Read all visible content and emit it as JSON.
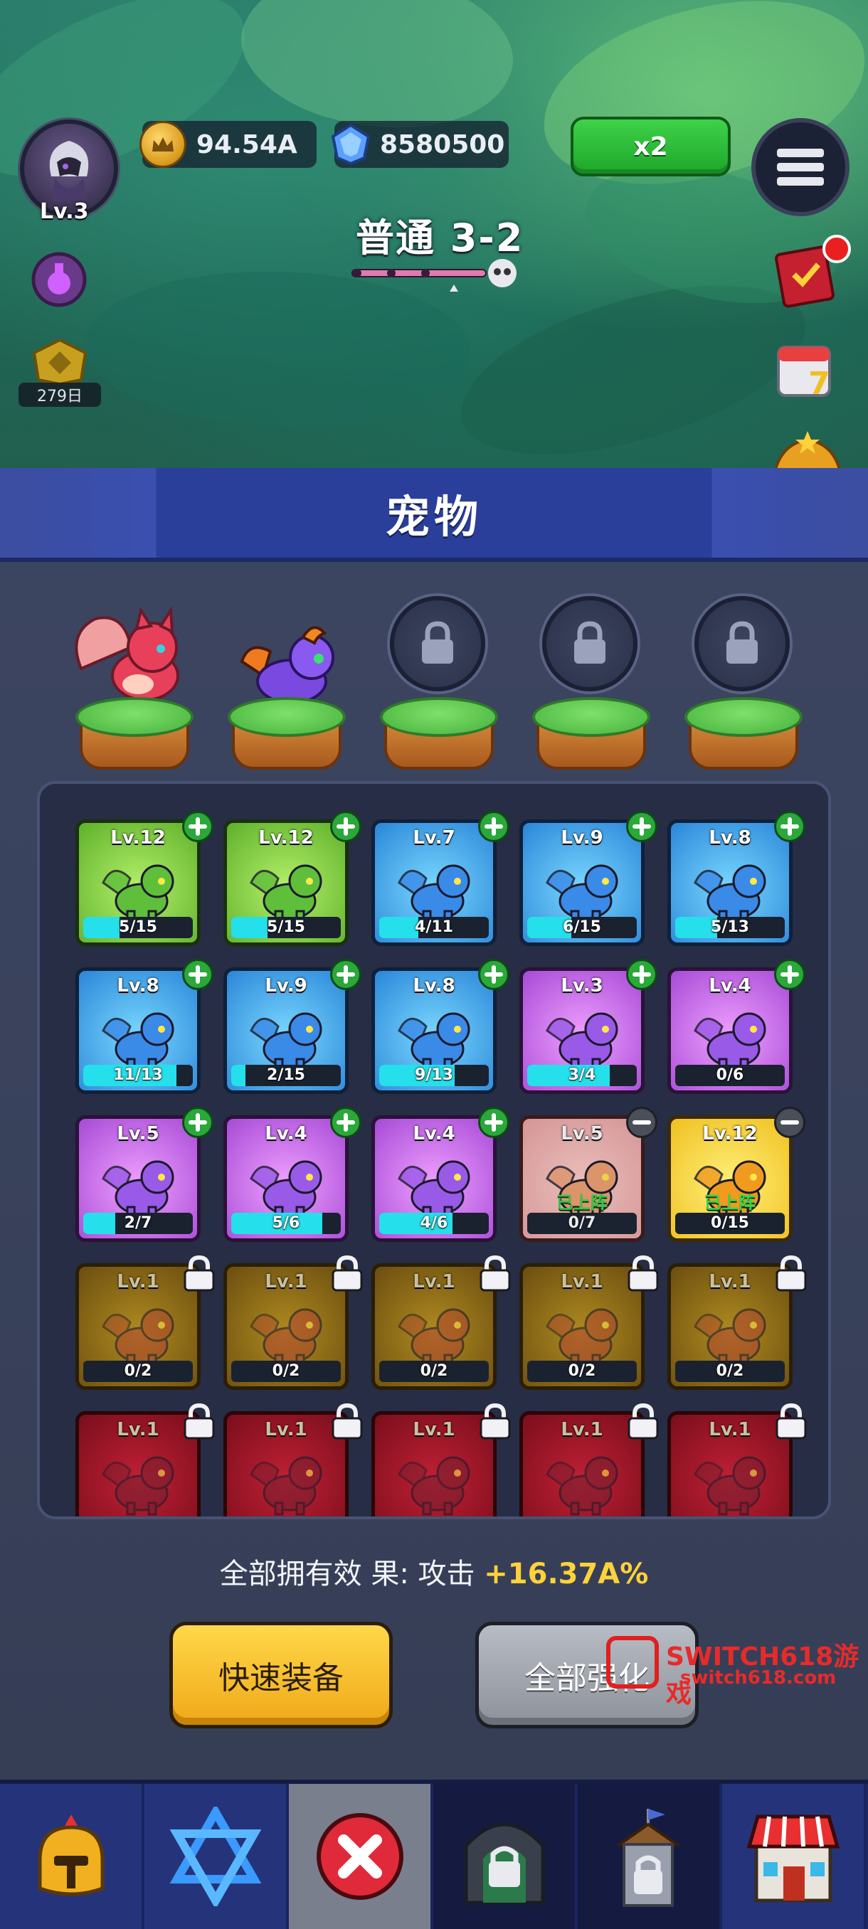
{
  "hud": {
    "player_level": "Lv.3",
    "coins": "94.54A",
    "gems": "8580500",
    "speed_label": "x2",
    "stage": "普通 3-2",
    "streak_days": "279日"
  },
  "panel": {
    "title": "宠物",
    "slots": [
      {
        "state": "occupied",
        "pet": "pink-fox"
      },
      {
        "state": "occupied",
        "pet": "purple-dragon"
      },
      {
        "state": "locked"
      },
      {
        "state": "locked"
      },
      {
        "state": "locked"
      }
    ],
    "pets": [
      {
        "level": "Lv.12",
        "progress": "5/15",
        "fill": 0.33,
        "rarity": "green",
        "badge": "plus"
      },
      {
        "level": "Lv.12",
        "progress": "5/15",
        "fill": 0.33,
        "rarity": "green",
        "badge": "plus"
      },
      {
        "level": "Lv.7",
        "progress": "4/11",
        "fill": 0.36,
        "rarity": "blue",
        "badge": "plus"
      },
      {
        "level": "Lv.9",
        "progress": "6/15",
        "fill": 0.4,
        "rarity": "blue",
        "badge": "plus"
      },
      {
        "level": "Lv.8",
        "progress": "5/13",
        "fill": 0.38,
        "rarity": "blue",
        "badge": "plus"
      },
      {
        "level": "Lv.8",
        "progress": "11/13",
        "fill": 0.85,
        "rarity": "blue",
        "badge": "plus"
      },
      {
        "level": "Lv.9",
        "progress": "2/15",
        "fill": 0.13,
        "rarity": "blue",
        "badge": "plus"
      },
      {
        "level": "Lv.8",
        "progress": "9/13",
        "fill": 0.69,
        "rarity": "blue",
        "badge": "plus"
      },
      {
        "level": "Lv.3",
        "progress": "3/4",
        "fill": 0.75,
        "rarity": "purple",
        "badge": "plus"
      },
      {
        "level": "Lv.4",
        "progress": "0/6",
        "fill": 0,
        "rarity": "purple",
        "badge": "plus"
      },
      {
        "level": "Lv.5",
        "progress": "2/7",
        "fill": 0.29,
        "rarity": "purple",
        "badge": "plus"
      },
      {
        "level": "Lv.4",
        "progress": "5/6",
        "fill": 0.83,
        "rarity": "purple",
        "badge": "plus"
      },
      {
        "level": "Lv.4",
        "progress": "4/6",
        "fill": 0.67,
        "rarity": "purple",
        "badge": "plus"
      },
      {
        "level": "Lv.5",
        "progress": "0/7",
        "fill": 0,
        "rarity": "pink",
        "badge": "minus",
        "tag": "已上阵"
      },
      {
        "level": "Lv.12",
        "progress": "0/15",
        "fill": 0,
        "rarity": "yellow",
        "badge": "minus",
        "tag": "已上阵"
      },
      {
        "level": "Lv.1",
        "progress": "0/2",
        "fill": 0,
        "rarity": "gold",
        "badge": "lock"
      },
      {
        "level": "Lv.1",
        "progress": "0/2",
        "fill": 0,
        "rarity": "gold",
        "badge": "lock"
      },
      {
        "level": "Lv.1",
        "progress": "0/2",
        "fill": 0,
        "rarity": "gold",
        "badge": "lock"
      },
      {
        "level": "Lv.1",
        "progress": "0/2",
        "fill": 0,
        "rarity": "gold",
        "badge": "lock"
      },
      {
        "level": "Lv.1",
        "progress": "0/2",
        "fill": 0,
        "rarity": "gold",
        "badge": "lock"
      },
      {
        "level": "Lv.1",
        "rarity": "red",
        "badge": "lock"
      },
      {
        "level": "Lv.1",
        "rarity": "red",
        "badge": "lock"
      },
      {
        "level": "Lv.1",
        "rarity": "red",
        "badge": "lock"
      },
      {
        "level": "Lv.1",
        "rarity": "red",
        "badge": "lock"
      },
      {
        "level": "Lv.1",
        "rarity": "red",
        "badge": "lock"
      }
    ],
    "effect_label": "全部拥有效 果: 攻击 ",
    "effect_value": "+16.37A%",
    "quick_equip_label": "快速装备",
    "upgrade_all_label": "全部强化"
  },
  "watermark": {
    "line1": "SWITCH618游戏",
    "line2": "switch618.com"
  },
  "nav": [
    {
      "icon": "helmet-icon",
      "state": "normal"
    },
    {
      "icon": "star-icon",
      "state": "normal"
    },
    {
      "icon": "close-icon",
      "state": "active"
    },
    {
      "icon": "locked-gate-icon",
      "state": "dim"
    },
    {
      "icon": "locked-tower-icon",
      "state": "dim"
    },
    {
      "icon": "shop-icon",
      "state": "normal"
    }
  ],
  "colors": {
    "panel_blue": "#2a3f9a",
    "cyan_progress": "#25e0ea",
    "effect_gold": "#ffd23a",
    "quick_equip": "#f0b020"
  }
}
